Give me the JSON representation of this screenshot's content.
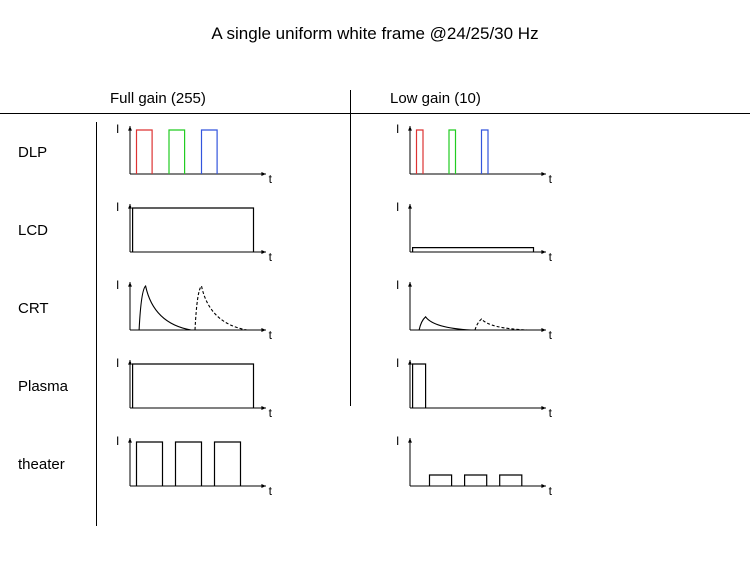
{
  "title": "A single uniform white frame @24/25/30 Hz",
  "columns": {
    "full": "Full gain (255)",
    "low": "Low gain (10)"
  },
  "rows": {
    "dlp": "DLP",
    "lcd": "LCD",
    "crt": "CRT",
    "plasma": "Plasma",
    "theater": "theater"
  },
  "axis": {
    "I": "I",
    "t": "t"
  },
  "chart_data": {
    "type": "line",
    "title": "A single uniform white frame @24/25/30 Hz",
    "xlabel": "t",
    "ylabel": "I",
    "ylim": [
      0,
      1
    ],
    "series": [
      {
        "name": "DLP full R",
        "color": "#d33",
        "row": "dlp",
        "col": "full",
        "shape": "rect",
        "x": [
          0.05,
          0.17
        ],
        "y": 1.0
      },
      {
        "name": "DLP full G",
        "color": "#2c2",
        "row": "dlp",
        "col": "full",
        "shape": "rect",
        "x": [
          0.3,
          0.42
        ],
        "y": 1.0
      },
      {
        "name": "DLP full B",
        "color": "#35d",
        "row": "dlp",
        "col": "full",
        "shape": "rect",
        "x": [
          0.55,
          0.67
        ],
        "y": 1.0
      },
      {
        "name": "DLP low R",
        "color": "#d33",
        "row": "dlp",
        "col": "low",
        "shape": "rect",
        "x": [
          0.05,
          0.1
        ],
        "y": 1.0
      },
      {
        "name": "DLP low G",
        "color": "#2c2",
        "row": "dlp",
        "col": "low",
        "shape": "rect",
        "x": [
          0.3,
          0.35
        ],
        "y": 1.0
      },
      {
        "name": "DLP low B",
        "color": "#35d",
        "row": "dlp",
        "col": "low",
        "shape": "rect",
        "x": [
          0.55,
          0.6
        ],
        "y": 1.0
      },
      {
        "name": "LCD full",
        "color": "#000",
        "row": "lcd",
        "col": "full",
        "shape": "rect",
        "x": [
          0.02,
          0.95
        ],
        "y": 1.0
      },
      {
        "name": "LCD low",
        "color": "#000",
        "row": "lcd",
        "col": "low",
        "shape": "rect",
        "x": [
          0.02,
          0.95
        ],
        "y": 0.1
      },
      {
        "name": "CRT full 1",
        "color": "#000",
        "row": "crt",
        "col": "full",
        "shape": "decay",
        "peak_x": 0.12,
        "peak_y": 1.0,
        "style": "solid"
      },
      {
        "name": "CRT full 2",
        "color": "#000",
        "row": "crt",
        "col": "full",
        "shape": "decay",
        "peak_x": 0.55,
        "peak_y": 1.0,
        "style": "dashed"
      },
      {
        "name": "CRT low 1",
        "color": "#000",
        "row": "crt",
        "col": "low",
        "shape": "decay",
        "peak_x": 0.12,
        "peak_y": 0.3,
        "style": "solid"
      },
      {
        "name": "CRT low 2",
        "color": "#000",
        "row": "crt",
        "col": "low",
        "shape": "decay",
        "peak_x": 0.55,
        "peak_y": 0.25,
        "style": "dashed"
      },
      {
        "name": "Plasma full",
        "color": "#000",
        "row": "plasma",
        "col": "full",
        "shape": "rect",
        "x": [
          0.02,
          0.95
        ],
        "y": 1.0
      },
      {
        "name": "Plasma low",
        "color": "#000",
        "row": "plasma",
        "col": "low",
        "shape": "rect",
        "x": [
          0.02,
          0.12
        ],
        "y": 1.0
      },
      {
        "name": "theater full 1",
        "color": "#000",
        "row": "theater",
        "col": "full",
        "shape": "rect",
        "x": [
          0.05,
          0.25
        ],
        "y": 1.0
      },
      {
        "name": "theater full 2",
        "color": "#000",
        "row": "theater",
        "col": "full",
        "shape": "rect",
        "x": [
          0.35,
          0.55
        ],
        "y": 1.0
      },
      {
        "name": "theater full 3",
        "color": "#000",
        "row": "theater",
        "col": "full",
        "shape": "rect",
        "x": [
          0.65,
          0.85
        ],
        "y": 1.0
      },
      {
        "name": "theater low 1",
        "color": "#000",
        "row": "theater",
        "col": "low",
        "shape": "rect",
        "x": [
          0.15,
          0.32
        ],
        "y": 0.25
      },
      {
        "name": "theater low 2",
        "color": "#000",
        "row": "theater",
        "col": "low",
        "shape": "rect",
        "x": [
          0.42,
          0.59
        ],
        "y": 0.25
      },
      {
        "name": "theater low 3",
        "color": "#000",
        "row": "theater",
        "col": "low",
        "shape": "rect",
        "x": [
          0.69,
          0.86
        ],
        "y": 0.25
      }
    ]
  }
}
